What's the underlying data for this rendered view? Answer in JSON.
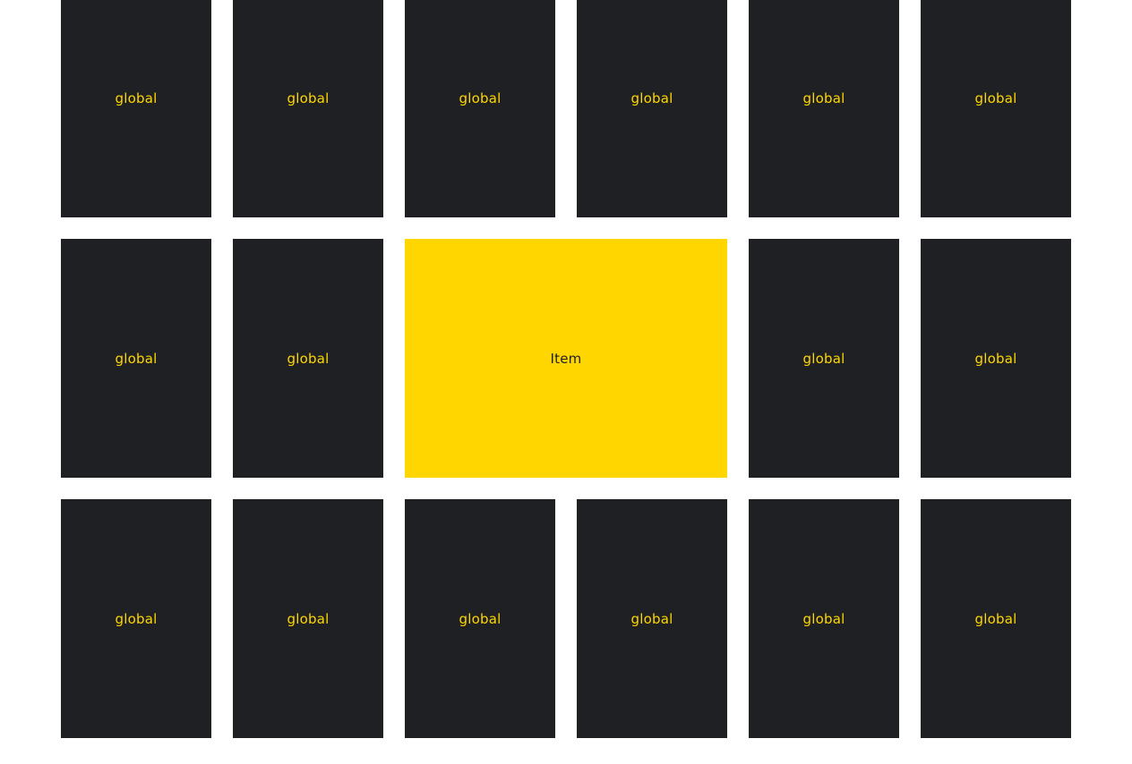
{
  "colors": {
    "tile_bg": "#1f2023",
    "accent": "#ffd600",
    "page_bg": "#ffffff"
  },
  "grid": {
    "rows": [
      {
        "tiles": [
          {
            "label": "global"
          },
          {
            "label": "global"
          },
          {
            "label": "global"
          },
          {
            "label": "global"
          },
          {
            "label": "global"
          },
          {
            "label": "global"
          }
        ]
      },
      {
        "tiles": [
          {
            "label": "global"
          },
          {
            "label": "global"
          },
          {
            "label": "Item",
            "featured": true
          },
          {
            "label": "global"
          },
          {
            "label": "global"
          }
        ]
      },
      {
        "tiles": [
          {
            "label": "global"
          },
          {
            "label": "global"
          },
          {
            "label": "global"
          },
          {
            "label": "global"
          },
          {
            "label": "global"
          },
          {
            "label": "global"
          }
        ]
      }
    ]
  }
}
